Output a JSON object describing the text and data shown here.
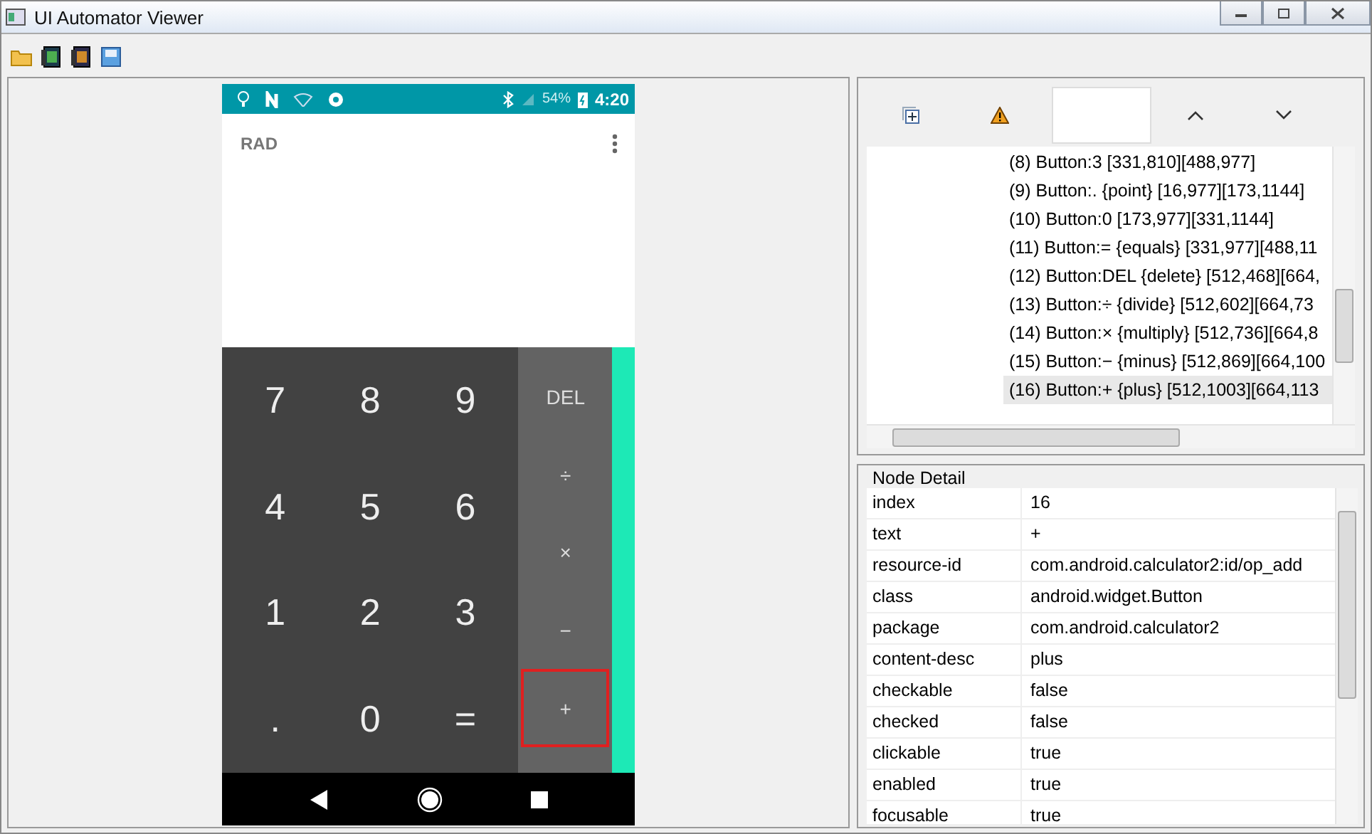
{
  "window": {
    "title": "UI Automator Viewer"
  },
  "device": {
    "status_bar": {
      "battery": "54%",
      "time": "4:20"
    },
    "display": {
      "mode": "RAD"
    },
    "digits": [
      [
        "7",
        "8",
        "9"
      ],
      [
        "4",
        "5",
        "6"
      ],
      [
        "1",
        "2",
        "3"
      ],
      [
        ".",
        "0",
        "="
      ]
    ],
    "operators": [
      {
        "label": "DEL",
        "selected": false
      },
      {
        "label": "÷",
        "selected": false
      },
      {
        "label": "×",
        "selected": false
      },
      {
        "label": "−",
        "selected": false
      },
      {
        "label": "+",
        "selected": true
      }
    ]
  },
  "tree": {
    "items": [
      {
        "label": "(8) Button:3 [331,810][488,977]",
        "selected": false
      },
      {
        "label": "(9) Button:. {point} [16,977][173,1144]",
        "selected": false
      },
      {
        "label": "(10) Button:0 [173,977][331,1144]",
        "selected": false
      },
      {
        "label": "(11) Button:= {equals} [331,977][488,11",
        "selected": false
      },
      {
        "label": "(12) Button:DEL {delete} [512,468][664,",
        "selected": false
      },
      {
        "label": "(13) Button:÷ {divide} [512,602][664,73",
        "selected": false
      },
      {
        "label": "(14) Button:× {multiply} [512,736][664,8",
        "selected": false
      },
      {
        "label": "(15) Button:− {minus} [512,869][664,100",
        "selected": false
      },
      {
        "label": "(16) Button:+ {plus} [512,1003][664,113",
        "selected": true
      }
    ]
  },
  "node_detail": {
    "title": "Node Detail",
    "rows": [
      {
        "name": "index",
        "value": "16"
      },
      {
        "name": "text",
        "value": "+"
      },
      {
        "name": "resource-id",
        "value": "com.android.calculator2:id/op_add"
      },
      {
        "name": "class",
        "value": "android.widget.Button"
      },
      {
        "name": "package",
        "value": "com.android.calculator2"
      },
      {
        "name": "content-desc",
        "value": "plus"
      },
      {
        "name": "checkable",
        "value": "false"
      },
      {
        "name": "checked",
        "value": "false"
      },
      {
        "name": "clickable",
        "value": "true"
      },
      {
        "name": "enabled",
        "value": "true"
      },
      {
        "name": "focusable",
        "value": "true"
      }
    ]
  }
}
